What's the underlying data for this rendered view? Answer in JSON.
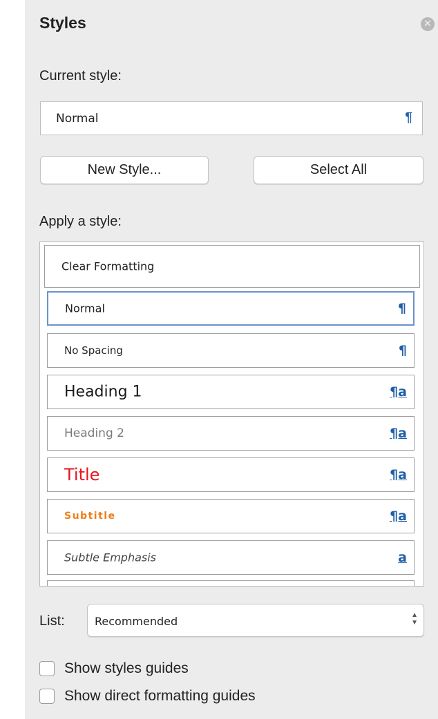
{
  "panel": {
    "title": "Styles",
    "close_icon": "close-x-icon"
  },
  "current_style": {
    "label": "Current style:",
    "value": "Normal",
    "glyph": "¶"
  },
  "buttons": {
    "new_style": "New Style...",
    "select_all": "Select All"
  },
  "apply": {
    "label": "Apply a style:",
    "items": [
      {
        "name": "Clear Formatting",
        "glyph": ""
      },
      {
        "name": "Normal",
        "glyph": "¶"
      },
      {
        "name": "No Spacing",
        "glyph": "¶"
      },
      {
        "name": "Heading 1",
        "glyph": "¶a"
      },
      {
        "name": "Heading 2",
        "glyph": "¶a"
      },
      {
        "name": "Title",
        "glyph": "¶a"
      },
      {
        "name": "Subtitle",
        "glyph": "¶a"
      },
      {
        "name": "Subtle Emphasis",
        "glyph": "a"
      },
      {
        "name": "",
        "glyph": ""
      }
    ]
  },
  "list": {
    "label": "List:",
    "value": "Recommended"
  },
  "options": {
    "show_styles_guides": "Show styles guides",
    "show_direct_formatting_guides": "Show direct formatting guides"
  },
  "colors": {
    "glyph_blue": "#1f5fa8",
    "title_red": "#e8141e",
    "subtitle_orange": "#f07c18",
    "heading2_gray": "#7a7a7a",
    "selected_border": "#6a93c9"
  }
}
